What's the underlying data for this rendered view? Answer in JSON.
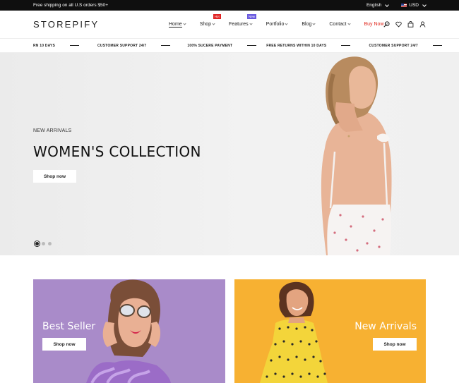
{
  "topbar": {
    "promo": "Free shipping on all U.S orders $50+",
    "language": "English",
    "currency": "USD"
  },
  "header": {
    "logo": "STOREPIFY",
    "nav": [
      {
        "label": "Home",
        "active": true
      },
      {
        "label": "Shop",
        "badge": "Hot"
      },
      {
        "label": "Features",
        "badge": "New"
      },
      {
        "label": "Portfolio"
      },
      {
        "label": "Blog"
      },
      {
        "label": "Contact"
      },
      {
        "label": "Buy Now"
      }
    ],
    "icons": [
      "search-icon",
      "heart-icon",
      "cart-icon",
      "user-icon"
    ]
  },
  "ticker": [
    "RN 10 DAYS",
    "CUSTOMER SUPPORT 24/7",
    "100% SUCERE PAYMENT",
    "FREE RETURNS WITHIN 10 DAYS",
    "CUSTOMER SUPPORT 24/7"
  ],
  "hero": {
    "subtitle": "NEW ARRIVALS",
    "title": "WOMEN'S COLLECTION",
    "button": "Shop now",
    "slides": 3,
    "active_slide": 1
  },
  "cards": [
    {
      "title": "Best Seller",
      "button": "Shop now",
      "color": "#a98bc9"
    },
    {
      "title": "New Arrivals",
      "button": "Shop now",
      "color": "#f7b132"
    }
  ],
  "colors": {
    "accent": "#e0261b",
    "hot": "#e02424",
    "new": "#6a5adf"
  }
}
